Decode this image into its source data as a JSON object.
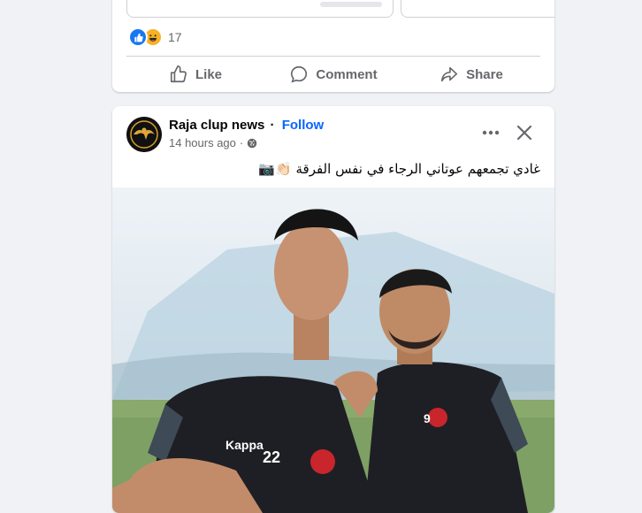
{
  "prev_post": {
    "reaction_icons": [
      "like-icon",
      "haha-icon"
    ],
    "reaction_count": "17",
    "actions": {
      "like": "Like",
      "comment": "Comment",
      "share": "Share"
    }
  },
  "post": {
    "page_name": "Raja clup news",
    "separator": "·",
    "follow_label": "Follow",
    "timestamp": "14 hours ago",
    "meta_separator": "·",
    "caption": "غادي تجمعهم عوتاني الرجاء في نفس الفرقة 👏🏻📷",
    "jersey_number_left": "22",
    "jersey_number_right": "9",
    "jersey_brand": "Kappa"
  },
  "colors": {
    "background": "#f0f2f5",
    "card": "#ffffff",
    "accent": "#0866ff",
    "muted_text": "#65676b",
    "divider": "#ced0d4"
  }
}
